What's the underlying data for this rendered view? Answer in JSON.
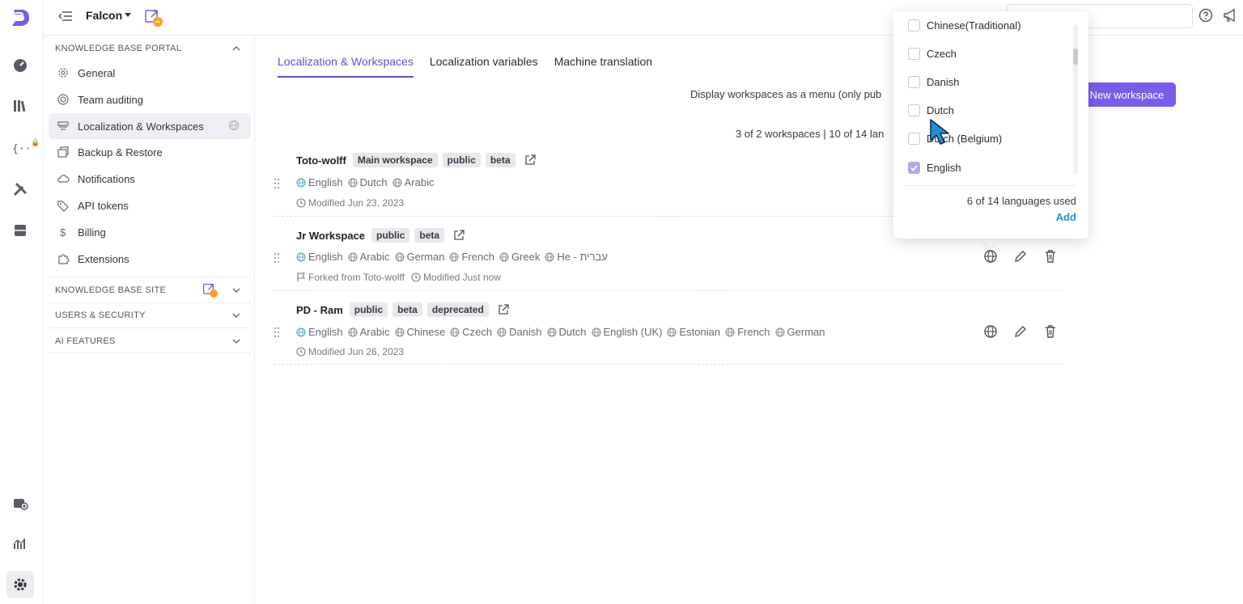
{
  "topbar": {
    "project_name": "Falcon"
  },
  "sidebar": {
    "sections": [
      {
        "title": "KNOWLEDGE BASE PORTAL"
      },
      {
        "title": "KNOWLEDGE BASE SITE"
      },
      {
        "title": "USERS & SECURITY"
      },
      {
        "title": "AI FEATURES"
      }
    ],
    "items": [
      {
        "label": "General"
      },
      {
        "label": "Team auditing"
      },
      {
        "label": "Localization & Workspaces"
      },
      {
        "label": "Backup & Restore"
      },
      {
        "label": "Notifications"
      },
      {
        "label": "API tokens"
      },
      {
        "label": "Billing"
      },
      {
        "label": "Extensions"
      }
    ]
  },
  "tabs": [
    {
      "label": "Localization & Workspaces"
    },
    {
      "label": "Localization variables"
    },
    {
      "label": "Machine translation"
    }
  ],
  "toolbar": {
    "menu_note": "Display workspaces as a menu (only pub",
    "new_workspace": "New workspace",
    "counts": "3 of 2 workspaces | 10 of 14 lan"
  },
  "workspaces": [
    {
      "name": "Toto-wolff",
      "tags": [
        "Main workspace",
        "public",
        "beta"
      ],
      "languages": [
        "English",
        "Dutch",
        "Arabic"
      ],
      "modified": "Modified Jun 23, 2023"
    },
    {
      "name": "Jr Workspace",
      "tags": [
        "public",
        "beta"
      ],
      "languages": [
        "English",
        "Arabic",
        "German",
        "French",
        "Greek",
        "He - עברית"
      ],
      "forked": "Forked from Toto-wolff",
      "modified": "Modified Just now"
    },
    {
      "name": "PD - Ram",
      "tags": [
        "public",
        "beta",
        "deprecated"
      ],
      "languages": [
        "English",
        "Arabic",
        "Chinese",
        "Czech",
        "Danish",
        "Dutch",
        "English (UK)",
        "Estonian",
        "French",
        "German"
      ],
      "modified": "Modified Jun 26, 2023"
    }
  ],
  "dropdown": {
    "options": [
      {
        "label": "Chinese(Traditional)",
        "checked": false
      },
      {
        "label": "Czech",
        "checked": false
      },
      {
        "label": "Danish",
        "checked": false
      },
      {
        "label": "Dutch",
        "checked": false
      },
      {
        "label": "Dutch (Belgium)",
        "checked": false
      },
      {
        "label": "English",
        "checked": true
      }
    ],
    "used_text": "6 of 14 languages used",
    "add_label": "Add"
  },
  "colors": {
    "accent": "#6a4bd8",
    "button": "#7b5cea",
    "link": "#2f8fd6"
  }
}
